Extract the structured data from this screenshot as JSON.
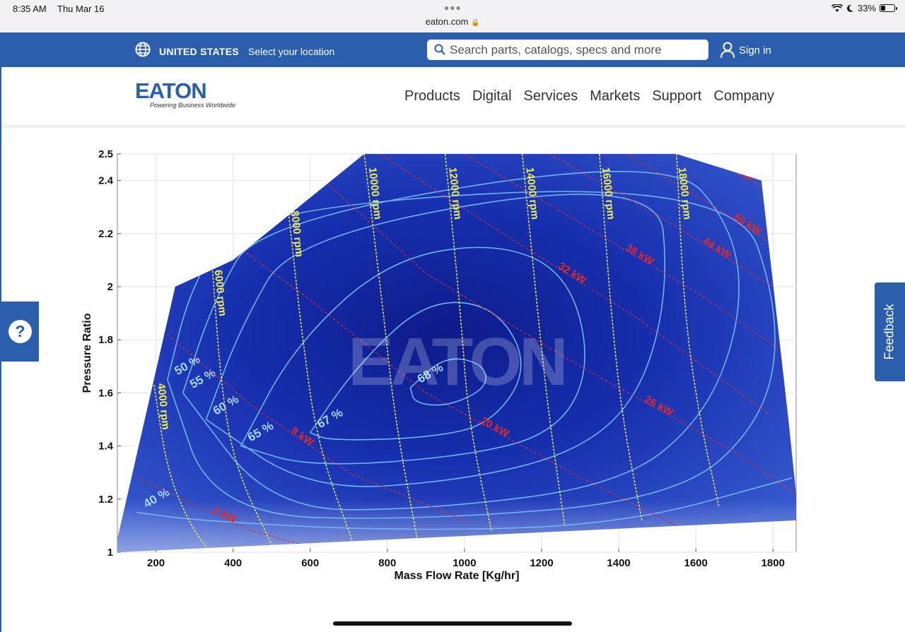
{
  "status_bar": {
    "time": "8:35 AM",
    "day": "Thu Mar 16",
    "url": "eaton.com",
    "battery": "33%"
  },
  "topbar": {
    "country": "UNITED STATES",
    "select_location": "Select your location",
    "search_placeholder": "Search parts, catalogs, specs and more",
    "sign_in": "Sign in"
  },
  "brand": {
    "logo_text": "EATON",
    "tagline": "Powering Business Worldwide",
    "color": "#2b5fad"
  },
  "nav": [
    "Products",
    "Digital",
    "Services",
    "Markets",
    "Support",
    "Company"
  ],
  "widgets": {
    "help": "?",
    "feedback": "Feedback"
  },
  "chart_data": {
    "type": "contour",
    "watermark": "EATON",
    "xlabel": "Mass Flow Rate [Kg/hr]",
    "ylabel": "Pressure Ratio",
    "xlim": [
      100,
      1860
    ],
    "ylim": [
      1,
      2.5
    ],
    "xticks": [
      200,
      400,
      600,
      800,
      1000,
      1200,
      1400,
      1600,
      1800
    ],
    "yticks": [
      1,
      1.2,
      1.4,
      1.6,
      1.8,
      2,
      2.2,
      2.4,
      2.5
    ],
    "grid": true,
    "map_boundary": [
      [
        100,
        1.0
      ],
      [
        1860,
        1.12
      ],
      [
        1860,
        1.22
      ],
      [
        1840,
        1.5
      ],
      [
        1770,
        2.4
      ],
      [
        1550,
        2.5
      ],
      [
        740,
        2.5
      ],
      [
        400,
        2.1
      ],
      [
        250,
        2.0
      ],
      [
        100,
        1.05
      ]
    ],
    "speed_lines": [
      {
        "label": "4000 rpm",
        "points": [
          [
            195,
            1.63
          ],
          [
            230,
            1.3
          ],
          [
            290,
            1.1
          ],
          [
            340,
            1.0
          ]
        ]
      },
      {
        "label": "6000 rpm",
        "points": [
          [
            345,
            2.1
          ],
          [
            370,
            1.6
          ],
          [
            410,
            1.3
          ],
          [
            510,
            1.0
          ]
        ]
      },
      {
        "label": "8000 rpm",
        "points": [
          [
            540,
            2.33
          ],
          [
            580,
            1.8
          ],
          [
            620,
            1.4
          ],
          [
            720,
            1.0
          ]
        ]
      },
      {
        "label": "10000 rpm",
        "points": [
          [
            740,
            2.5
          ],
          [
            790,
            1.9
          ],
          [
            820,
            1.5
          ],
          [
            880,
            1.03
          ]
        ]
      },
      {
        "label": "12000 rpm",
        "points": [
          [
            950,
            2.5
          ],
          [
            990,
            1.9
          ],
          [
            1010,
            1.5
          ],
          [
            1070,
            1.08
          ]
        ]
      },
      {
        "label": "14000 rpm",
        "points": [
          [
            1150,
            2.5
          ],
          [
            1190,
            1.9
          ],
          [
            1220,
            1.5
          ],
          [
            1260,
            1.1
          ]
        ]
      },
      {
        "label": "16000 rpm",
        "points": [
          [
            1350,
            2.5
          ],
          [
            1380,
            1.9
          ],
          [
            1410,
            1.5
          ],
          [
            1460,
            1.12
          ]
        ]
      },
      {
        "label": "18000 rpm",
        "points": [
          [
            1550,
            2.5
          ],
          [
            1570,
            1.9
          ],
          [
            1610,
            1.5
          ],
          [
            1660,
            1.17
          ]
        ]
      }
    ],
    "power_lines": [
      {
        "label": "2 kW",
        "points": [
          [
            150,
            1.28
          ],
          [
            300,
            1.18
          ],
          [
            450,
            1.08
          ],
          [
            600,
            1.02
          ]
        ]
      },
      {
        "label": "8 kW",
        "points": [
          [
            230,
            1.82
          ],
          [
            450,
            1.55
          ],
          [
            700,
            1.3
          ],
          [
            1000,
            1.12
          ]
        ]
      },
      {
        "label": "20 kW",
        "points": [
          [
            320,
            2.25
          ],
          [
            600,
            1.95
          ],
          [
            900,
            1.6
          ],
          [
            1250,
            1.32
          ],
          [
            1550,
            1.1
          ]
        ]
      },
      {
        "label": "26 kW",
        "points": [
          [
            560,
            2.5
          ],
          [
            900,
            2.05
          ],
          [
            1300,
            1.7
          ],
          [
            1700,
            1.38
          ],
          [
            1860,
            1.22
          ]
        ]
      },
      {
        "label": "32 kW",
        "points": [
          [
            780,
            2.5
          ],
          [
            1100,
            2.2
          ],
          [
            1450,
            1.88
          ],
          [
            1790,
            1.52
          ]
        ]
      },
      {
        "label": "38 kW",
        "points": [
          [
            1000,
            2.5
          ],
          [
            1300,
            2.24
          ],
          [
            1600,
            1.98
          ],
          [
            1830,
            1.75
          ]
        ]
      },
      {
        "label": "44 kW",
        "points": [
          [
            1220,
            2.5
          ],
          [
            1500,
            2.27
          ],
          [
            1800,
            2.0
          ]
        ]
      },
      {
        "label": "50 kW",
        "points": [
          [
            1420,
            2.5
          ],
          [
            1650,
            2.3
          ],
          [
            1810,
            2.15
          ]
        ]
      },
      {
        "label": "56 kW",
        "points": [
          [
            1620,
            2.5
          ],
          [
            1800,
            2.35
          ]
        ]
      }
    ],
    "efficiency_lines": [
      {
        "label": "68 %",
        "points": [
          [
            860,
            1.62
          ],
          [
            950,
            1.74
          ],
          [
            1050,
            1.71
          ],
          [
            1060,
            1.62
          ],
          [
            960,
            1.55
          ],
          [
            870,
            1.56
          ],
          [
            860,
            1.62
          ]
        ]
      },
      {
        "label": "67 %",
        "points": [
          [
            600,
            1.45
          ],
          [
            720,
            1.7
          ],
          [
            900,
            1.95
          ],
          [
            1080,
            1.93
          ],
          [
            1170,
            1.7
          ],
          [
            1070,
            1.48
          ],
          [
            900,
            1.43
          ],
          [
            650,
            1.42
          ],
          [
            600,
            1.45
          ]
        ]
      },
      {
        "label": "65 %",
        "points": [
          [
            420,
            1.4
          ],
          [
            560,
            1.78
          ],
          [
            800,
            2.1
          ],
          [
            1080,
            2.17
          ],
          [
            1270,
            2.05
          ],
          [
            1330,
            1.7
          ],
          [
            1240,
            1.45
          ],
          [
            1000,
            1.36
          ],
          [
            600,
            1.32
          ],
          [
            420,
            1.4
          ]
        ]
      },
      {
        "label": "60 %",
        "points": [
          [
            330,
            1.5
          ],
          [
            420,
            1.85
          ],
          [
            560,
            2.2
          ],
          [
            1500,
            2.42
          ],
          [
            1530,
            2.0
          ],
          [
            1460,
            1.6
          ],
          [
            1300,
            1.38
          ],
          [
            1000,
            1.27
          ],
          [
            600,
            1.23
          ],
          [
            330,
            1.5
          ]
        ]
      },
      {
        "label": "55 %",
        "points": [
          [
            270,
            1.6
          ],
          [
            350,
            1.95
          ],
          [
            470,
            2.25
          ],
          [
            1530,
            2.5
          ],
          [
            1700,
            2.22
          ],
          [
            1720,
            1.88
          ],
          [
            1620,
            1.5
          ],
          [
            1400,
            1.25
          ],
          [
            900,
            1.16
          ],
          [
            500,
            1.16
          ],
          [
            270,
            1.6
          ]
        ]
      },
      {
        "label": "50 %",
        "points": [
          [
            230,
            1.65
          ],
          [
            290,
            2.0
          ],
          [
            420,
            2.3
          ],
          [
            1700,
            2.4
          ],
          [
            1820,
            1.9
          ],
          [
            1780,
            1.5
          ],
          [
            1550,
            1.2
          ],
          [
            900,
            1.12
          ],
          [
            350,
            1.14
          ],
          [
            230,
            1.65
          ]
        ]
      },
      {
        "label": "40 %",
        "points": [
          [
            150,
            1.15
          ],
          [
            300,
            1.12
          ],
          [
            800,
            1.08
          ],
          [
            1400,
            1.1
          ],
          [
            1850,
            1.28
          ]
        ]
      }
    ]
  }
}
